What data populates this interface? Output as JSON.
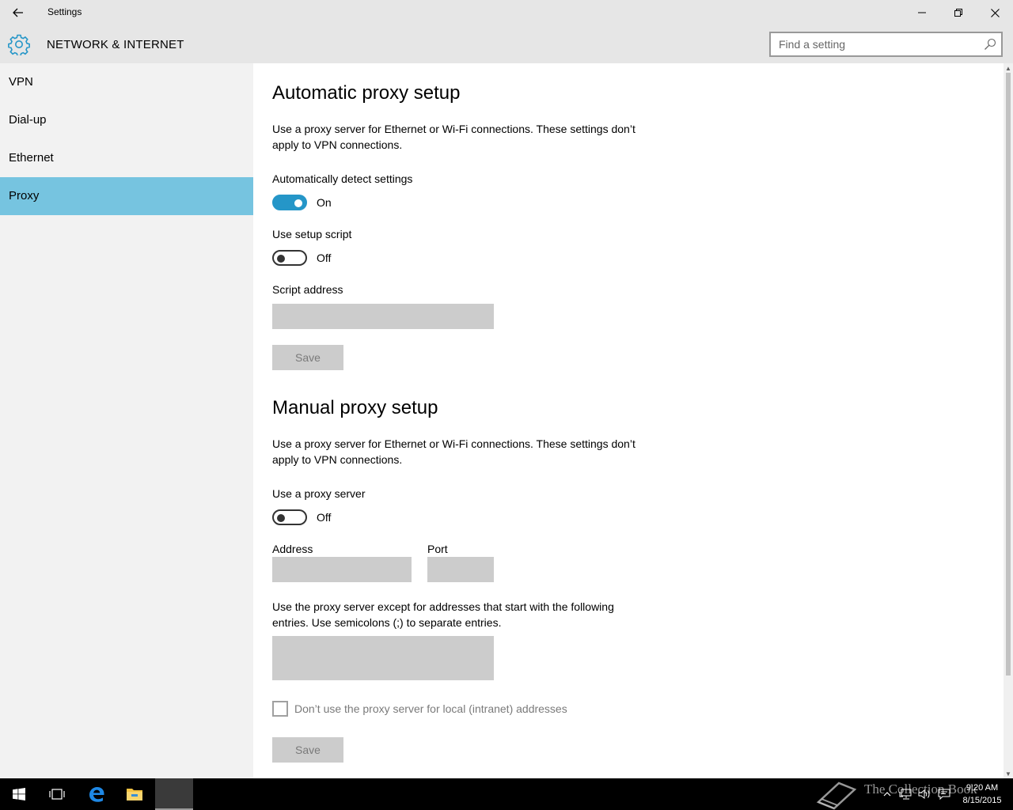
{
  "window": {
    "title": "Settings"
  },
  "header": {
    "title": "NETWORK & INTERNET",
    "search_placeholder": "Find a setting"
  },
  "sidebar": {
    "items": [
      {
        "label": "VPN",
        "active": false
      },
      {
        "label": "Dial-up",
        "active": false
      },
      {
        "label": "Ethernet",
        "active": false
      },
      {
        "label": "Proxy",
        "active": true
      }
    ]
  },
  "auto": {
    "title": "Automatic proxy setup",
    "desc": "Use a proxy server for Ethernet or Wi-Fi connections. These settings don’t apply to VPN connections.",
    "detect_label": "Automatically detect settings",
    "detect_state": "On",
    "script_label": "Use setup script",
    "script_state": "Off",
    "address_label": "Script address",
    "address_value": "",
    "save_label": "Save"
  },
  "manual": {
    "title": "Manual proxy setup",
    "desc": "Use a proxy server for Ethernet or Wi-Fi connections. These settings don’t apply to VPN connections.",
    "use_label": "Use a proxy server",
    "use_state": "Off",
    "address_label": "Address",
    "port_label": "Port",
    "address_value": "",
    "port_value": "",
    "exceptions_desc": "Use the proxy server except for addresses that start with the following entries. Use semicolons (;) to separate entries.",
    "exceptions_value": "",
    "local_checkbox_label": "Don’t use the proxy server for local (intranet) addresses",
    "save_label": "Save"
  },
  "taskbar": {
    "time": "9:20 AM",
    "date": "8/15/2015",
    "watermark": "The Collection Book"
  },
  "colors": {
    "accent": "#2596c8",
    "nav_active": "#76c4e0",
    "chrome": "#e6e6e6",
    "sidebar": "#f2f2f2"
  }
}
